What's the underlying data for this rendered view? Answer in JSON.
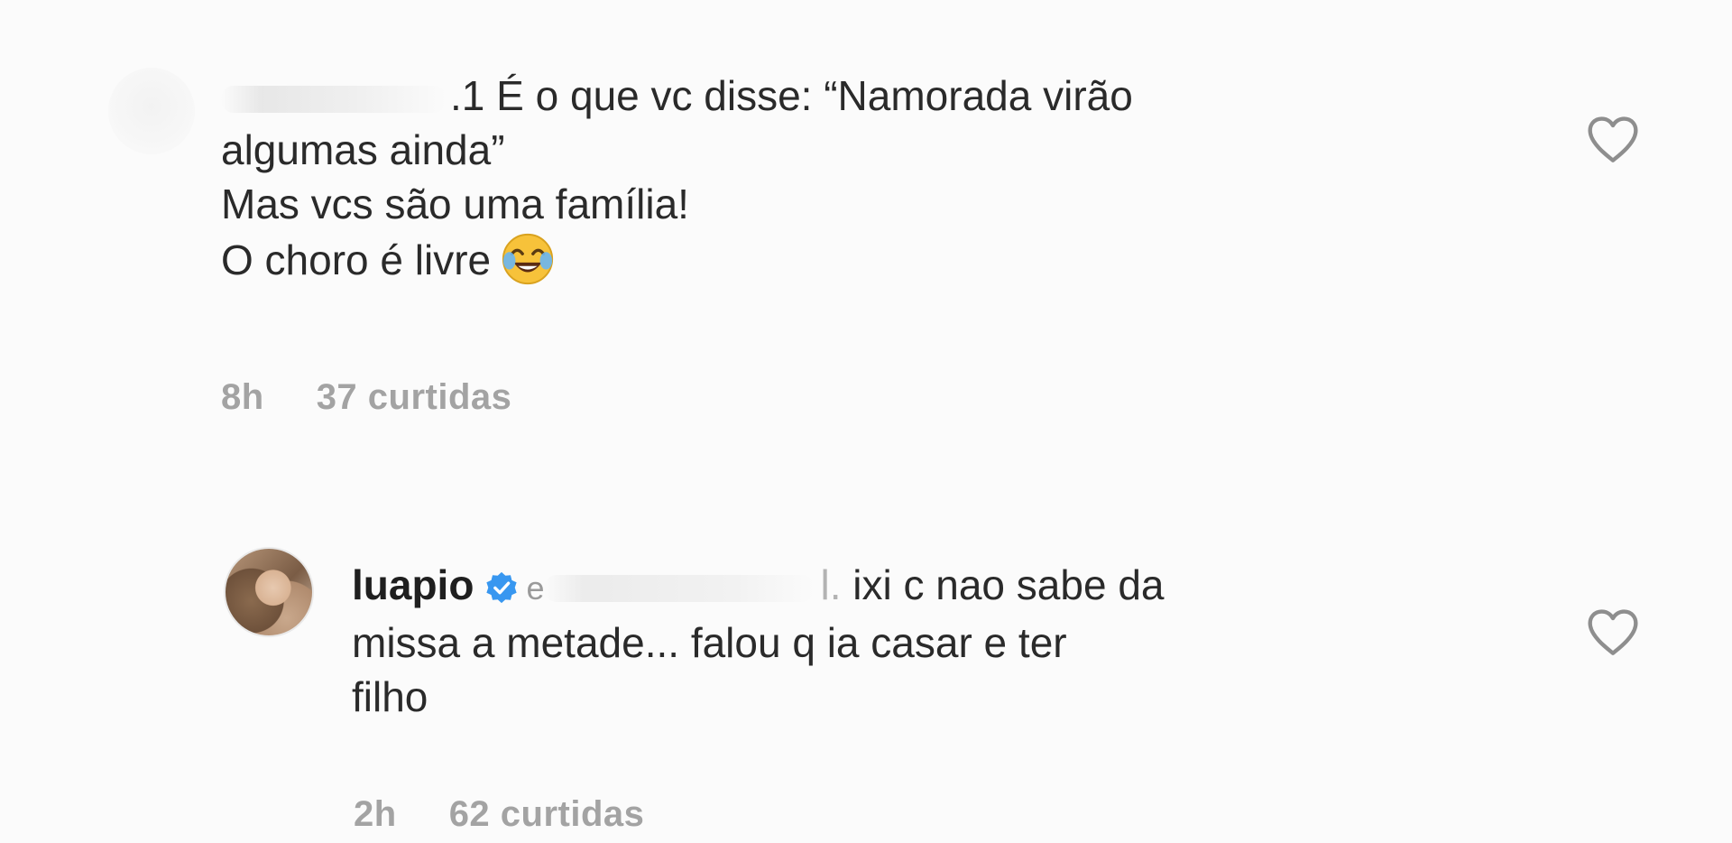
{
  "comments": [
    {
      "username": "",
      "mention_prefix": ".1",
      "lines": [
        "É o que vc disse: “Namorada virão",
        "algumas ainda”",
        "Mas vcs são uma família!",
        "O choro é livre"
      ],
      "emoji": "tears-of-joy-emoji",
      "time": "8h",
      "likes": "37 curtidas",
      "heart_icon": "heart-outline-icon"
    },
    {
      "username": "luapio",
      "verified_icon": "verified-badge-icon",
      "mention_prefix": "e",
      "mention_suffix": "l.",
      "lines": [
        "ixi c nao sabe da",
        "missa a metade... falou q ia casar e ter",
        "filho"
      ],
      "time": "2h",
      "likes": "62 curtidas",
      "heart_icon": "heart-outline-icon"
    }
  ],
  "colors": {
    "background": "#fbfbfb",
    "text": "#262626",
    "meta": "#a3a3a3",
    "verified": "#3897f0"
  }
}
